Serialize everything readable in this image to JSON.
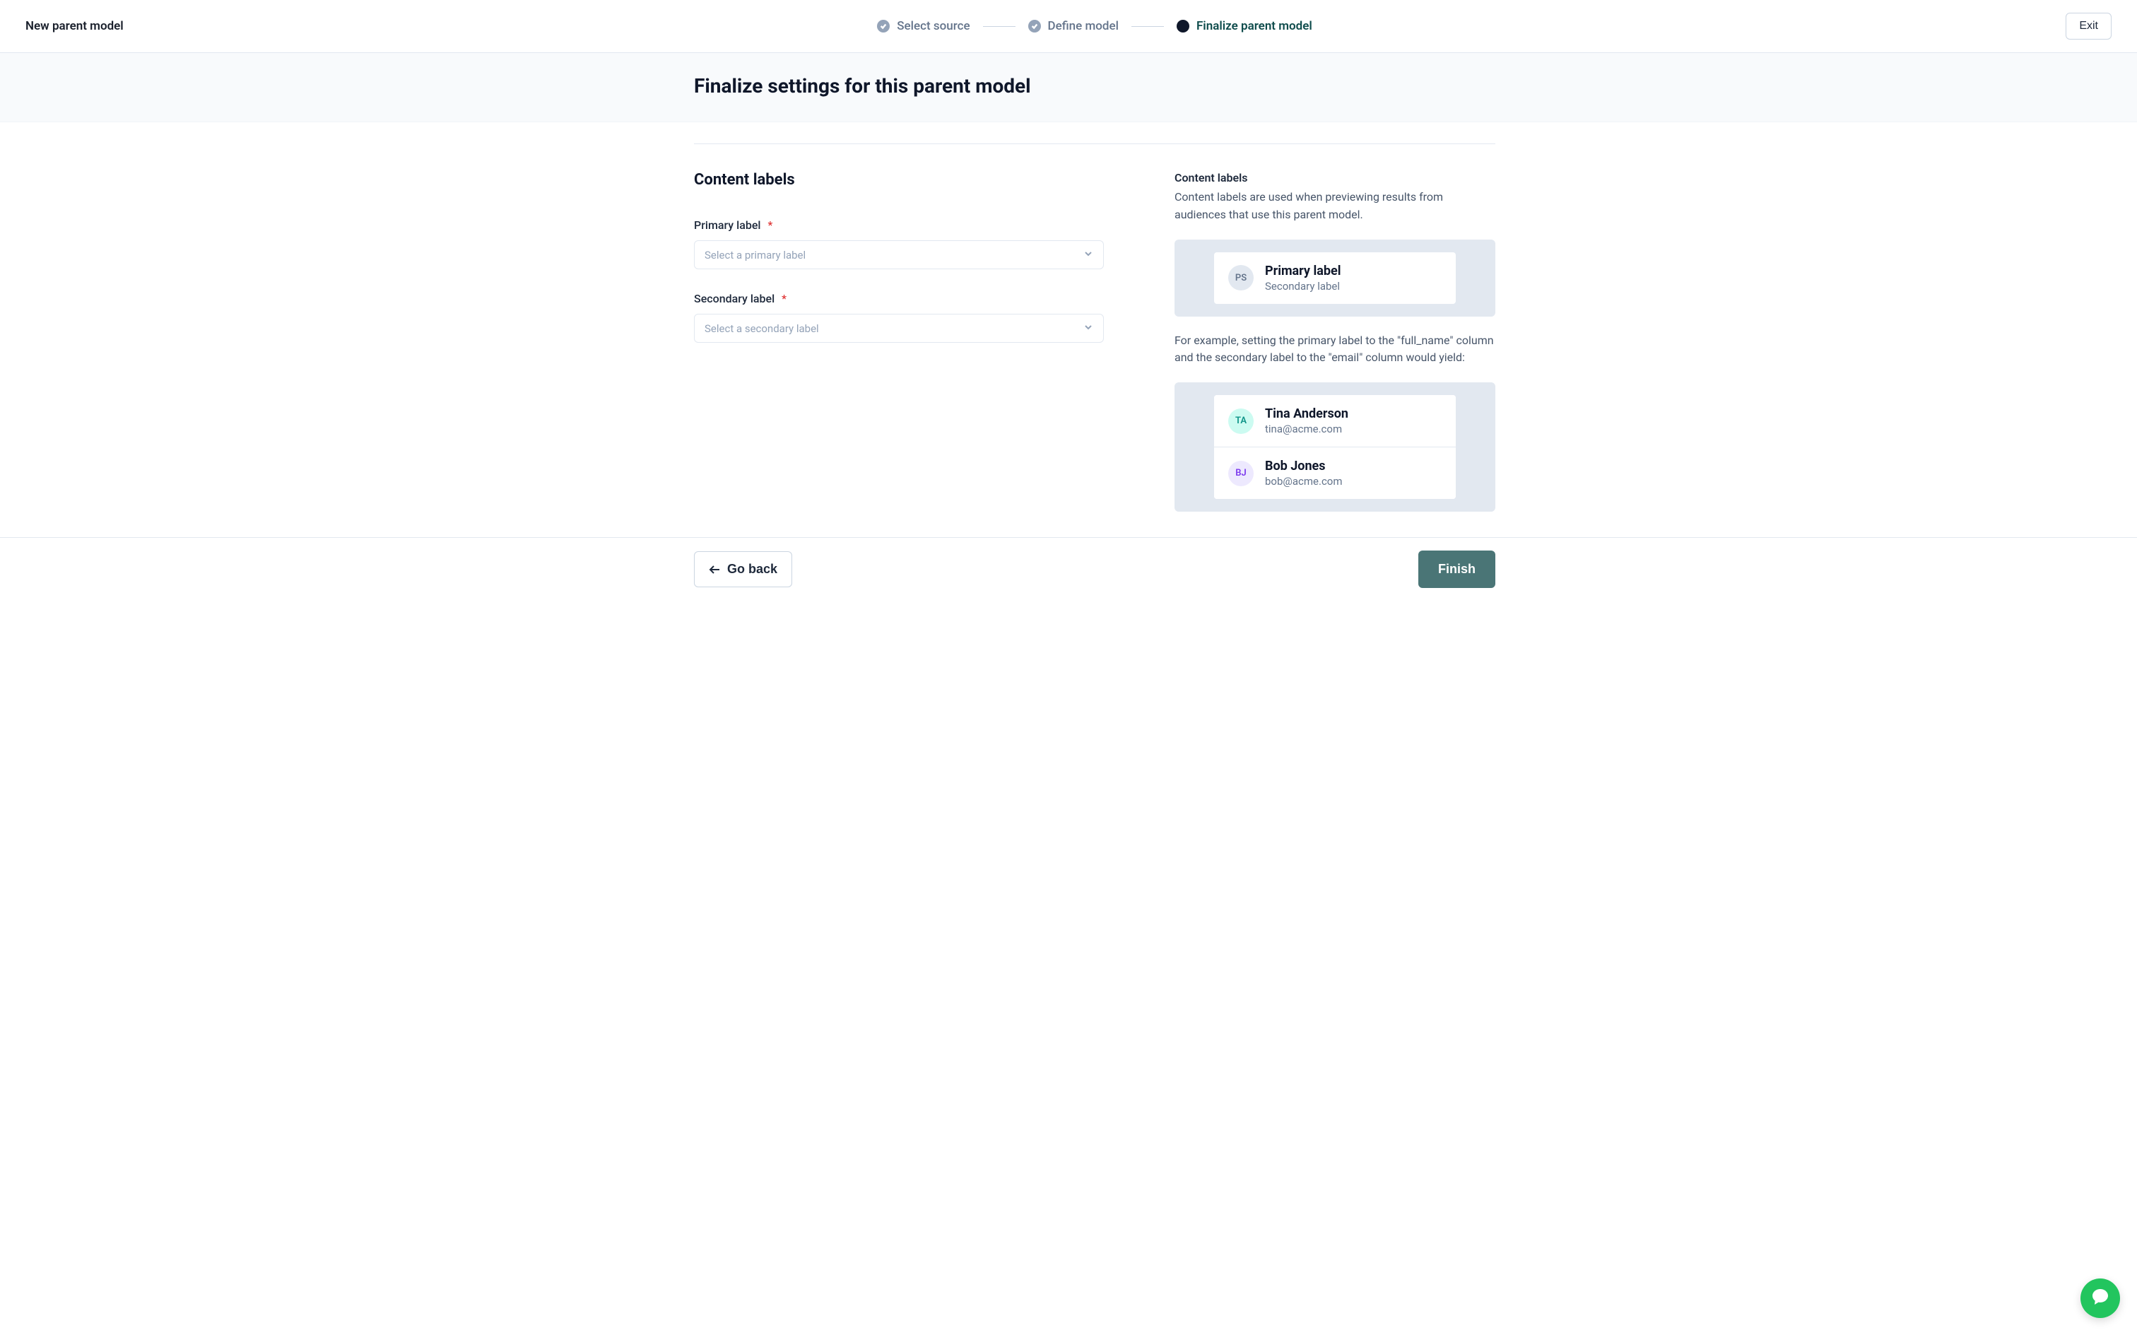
{
  "header": {
    "title": "New parent model",
    "exit_label": "Exit"
  },
  "steps": [
    {
      "label": "Select source",
      "status": "done"
    },
    {
      "label": "Define model",
      "status": "done"
    },
    {
      "label": "Finalize parent model",
      "status": "active"
    }
  ],
  "page": {
    "title": "Finalize settings for this parent model",
    "section_heading": "Content labels"
  },
  "fields": {
    "primary": {
      "label": "Primary label",
      "required_marker": "*",
      "placeholder": "Select a primary label",
      "value": ""
    },
    "secondary": {
      "label": "Secondary label",
      "required_marker": "*",
      "placeholder": "Select a secondary label",
      "value": ""
    }
  },
  "help": {
    "title": "Content labels",
    "description": "Content labels are used when previewing results from audiences that use this parent model.",
    "example_intro": "For example, setting the primary label to the \"full_name\" column and the secondary label to the \"email\" column would yield:"
  },
  "preview_generic": {
    "initials": "PS",
    "primary": "Primary label",
    "secondary": "Secondary label"
  },
  "preview_examples": [
    {
      "initials": "TA",
      "primary": "Tina Anderson",
      "secondary": "tina@acme.com",
      "avatar_class": "avatar-teal"
    },
    {
      "initials": "BJ",
      "primary": "Bob Jones",
      "secondary": "bob@acme.com",
      "avatar_class": "avatar-purple"
    }
  ],
  "footer": {
    "back_label": "Go back",
    "finish_label": "Finish"
  }
}
